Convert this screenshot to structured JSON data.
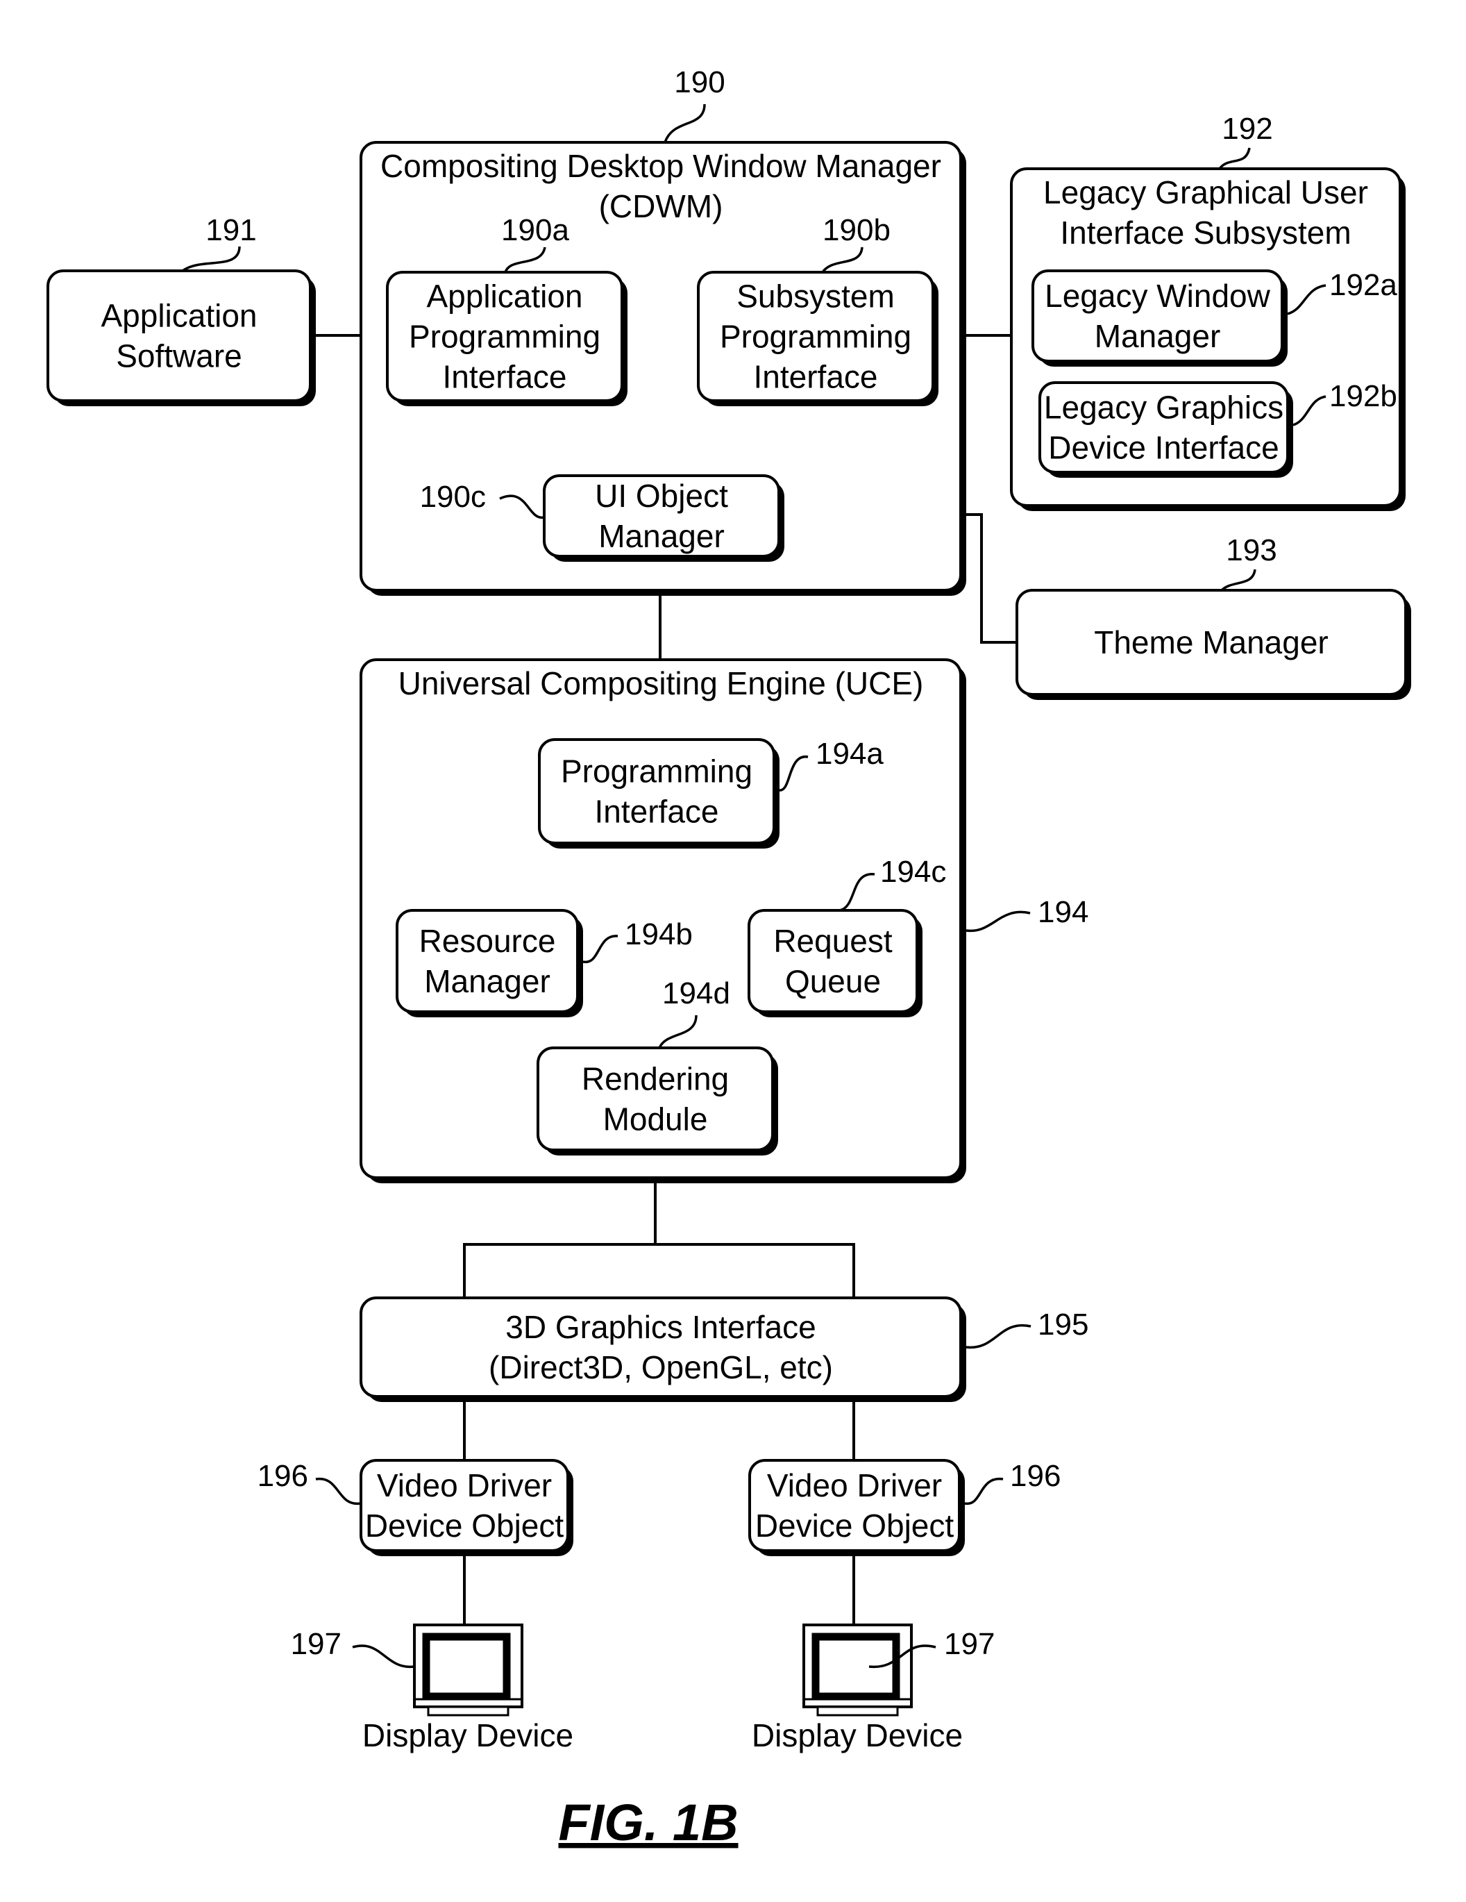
{
  "figure": {
    "caption": "FIG. 1B"
  },
  "blocks": {
    "cdwm": {
      "ref": "190",
      "lines": [
        "Compositing Desktop Window Manager",
        "(CDWM)"
      ]
    },
    "api": {
      "ref": "190a",
      "lines": [
        "Application",
        "Programming",
        "Interface"
      ]
    },
    "spi": {
      "ref": "190b",
      "lines": [
        "Subsystem",
        "Programming",
        "Interface"
      ]
    },
    "uiom": {
      "ref": "190c",
      "lines": [
        "UI Object",
        "Manager"
      ]
    },
    "appsw": {
      "ref": "191",
      "lines": [
        "Application",
        "Software"
      ]
    },
    "legacy": {
      "ref": "192",
      "lines": [
        "Legacy Graphical User",
        "Interface Subsystem"
      ]
    },
    "lwm": {
      "ref": "192a",
      "lines": [
        "Legacy Window",
        "Manager"
      ]
    },
    "lgdi": {
      "ref": "192b",
      "lines": [
        "Legacy Graphics",
        "Device Interface"
      ]
    },
    "theme": {
      "ref": "193",
      "lines": [
        "Theme Manager"
      ]
    },
    "uce": {
      "ref": "194",
      "lines": [
        "Universal Compositing Engine (UCE)"
      ]
    },
    "pi": {
      "ref": "194a",
      "lines": [
        "Programming",
        "Interface"
      ]
    },
    "rm": {
      "ref": "194b",
      "lines": [
        "Resource",
        "Manager"
      ]
    },
    "rq": {
      "ref": "194c",
      "lines": [
        "Request",
        "Queue"
      ]
    },
    "rend": {
      "ref": "194d",
      "lines": [
        "Rendering",
        "Module"
      ]
    },
    "gfx3d": {
      "ref": "195",
      "lines": [
        "3D Graphics Interface",
        "(Direct3D, OpenGL, etc)"
      ]
    },
    "vdL": {
      "ref": "196",
      "lines": [
        "Video Driver",
        "Device Object"
      ]
    },
    "vdR": {
      "ref": "196",
      "lines": [
        "Video Driver",
        "Device Object"
      ]
    },
    "dispL": {
      "ref": "197",
      "lines": [
        "Display Device"
      ]
    },
    "dispR": {
      "ref": "197",
      "lines": [
        "Display Device"
      ]
    }
  }
}
